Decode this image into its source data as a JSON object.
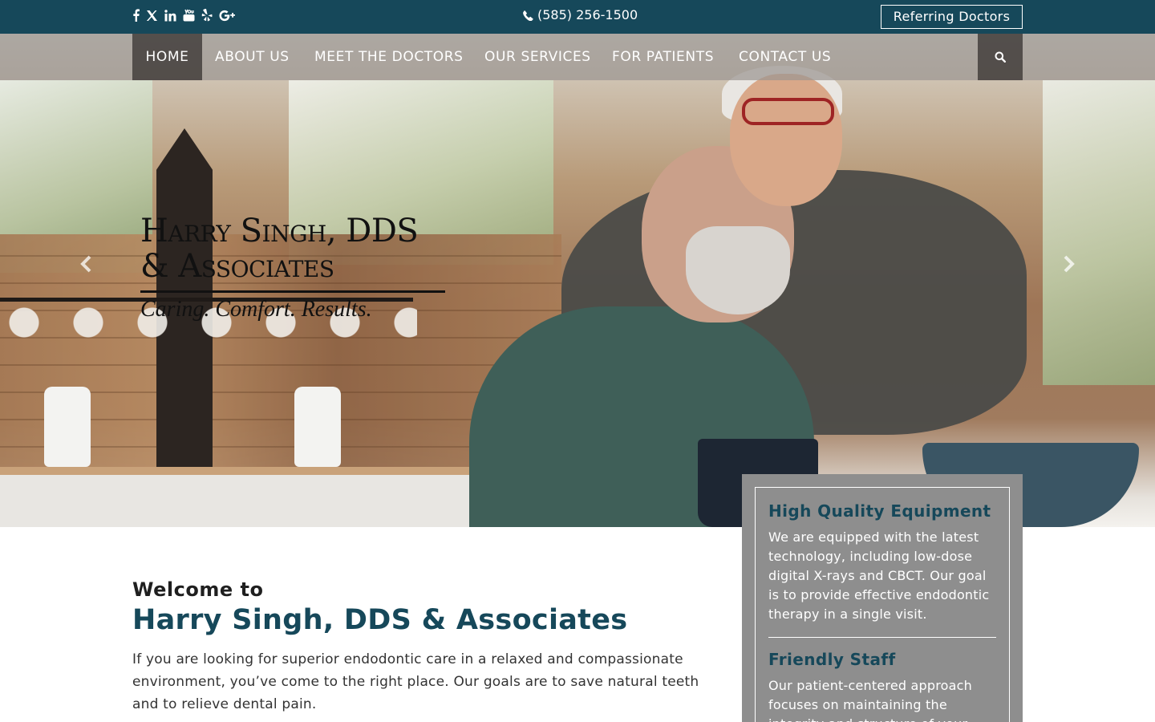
{
  "topbar": {
    "social_icons": [
      "facebook-icon",
      "x-twitter-icon",
      "linkedin-icon",
      "youtube-icon",
      "yelp-icon",
      "google-plus-icon"
    ],
    "phone": "(585) 256-1500",
    "referring_label": "Referring Doctors"
  },
  "nav": {
    "items": [
      {
        "label": "HOME",
        "active": true
      },
      {
        "label": "ABOUT US"
      },
      {
        "label": "MEET THE DOCTORS"
      },
      {
        "label": "OUR SERVICES"
      },
      {
        "label": "FOR PATIENTS"
      },
      {
        "label": "CONTACT US"
      }
    ],
    "search_icon": "search-icon"
  },
  "hero": {
    "logo_line1": "Harry Singh, DDS",
    "logo_line2": "& Associates",
    "tagline": "Caring. Comfort. Results.",
    "prev_icon": "chevron-left-icon",
    "next_icon": "chevron-right-icon"
  },
  "welcome": {
    "subtitle": "Welcome to",
    "title": "Harry Singh, DDS & Associates",
    "body": "If you are looking for superior endodontic care in a relaxed and compassionate environment, you’ve come to the right place. Our goals are to save natural teeth and to relieve dental pain."
  },
  "features": [
    {
      "title": "High Quality Equipment",
      "body": "We are equipped with the latest technology, including low-dose digital X-rays and CBCT. Our goal is to provide effective endodontic therapy in a single visit."
    },
    {
      "title": "Friendly Staff",
      "body": "Our patient-centered approach focuses on maintaining the integrity and structure of your"
    }
  ],
  "colors": {
    "topbar": "#16485a",
    "accent": "#16485a",
    "panel": "#8e8e8e"
  }
}
